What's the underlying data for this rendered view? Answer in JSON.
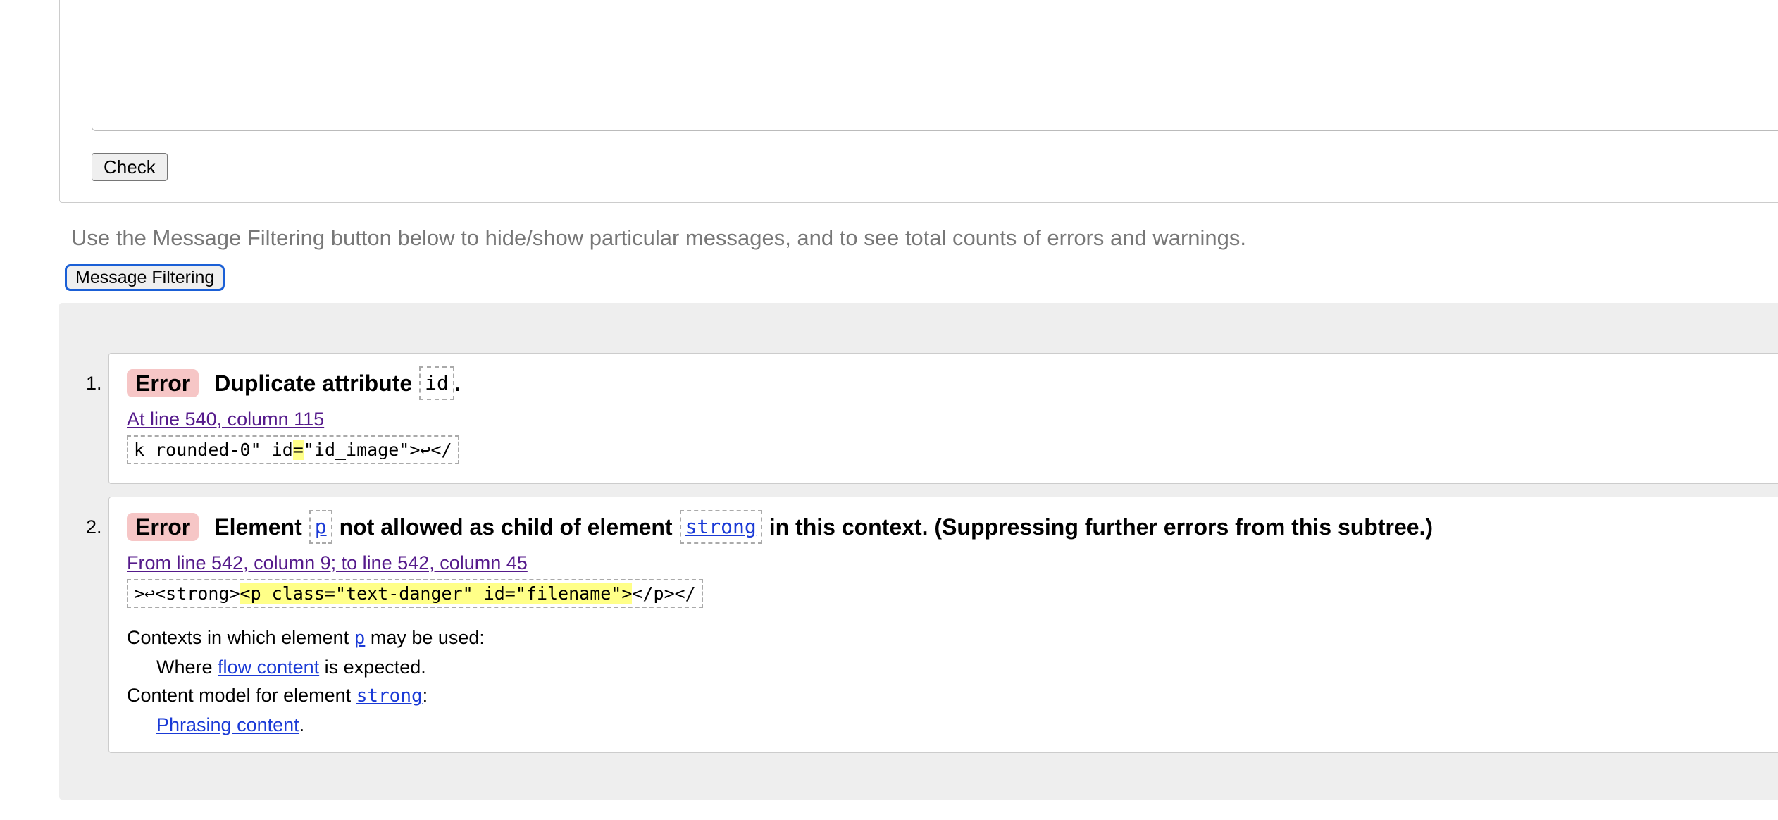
{
  "form": {
    "check_label": "Check"
  },
  "filter": {
    "note": "Use the Message Filtering button below to hide/show particular messages, and to see total counts of errors and warnings.",
    "button_label": "Message Filtering"
  },
  "messages": [
    {
      "number": "1.",
      "type": "Error",
      "title_pre": "Duplicate attribute",
      "title_code": "id",
      "title_post": ".",
      "location": "At line 540, column 115",
      "extract_pre": "k rounded-0\" id",
      "extract_hl": "=",
      "extract_post": "\"id_image\">↩</"
    },
    {
      "number": "2.",
      "type": "Error",
      "title_part1": "Element",
      "title_code1": "p",
      "title_part2": "not allowed as child of element",
      "title_code2": "strong",
      "title_part3": "in this context. (Suppressing further errors from this subtree.)",
      "location": "From line 542, column 9; to line 542, column 45",
      "extract_pre": ">↩<strong>",
      "extract_hl": "<p class=\"text-danger\" id=\"filename\">",
      "extract_post": "</p></",
      "contexts_pre": "Contexts in which element",
      "contexts_code": "p",
      "contexts_post": "may be used:",
      "where_pre": "Where",
      "where_link": "flow content",
      "where_post": "is expected.",
      "model_pre": "Content model for element",
      "model_code": "strong",
      "model_post": ":",
      "phrasing_link": "Phrasing content",
      "phrasing_post": "."
    }
  ]
}
